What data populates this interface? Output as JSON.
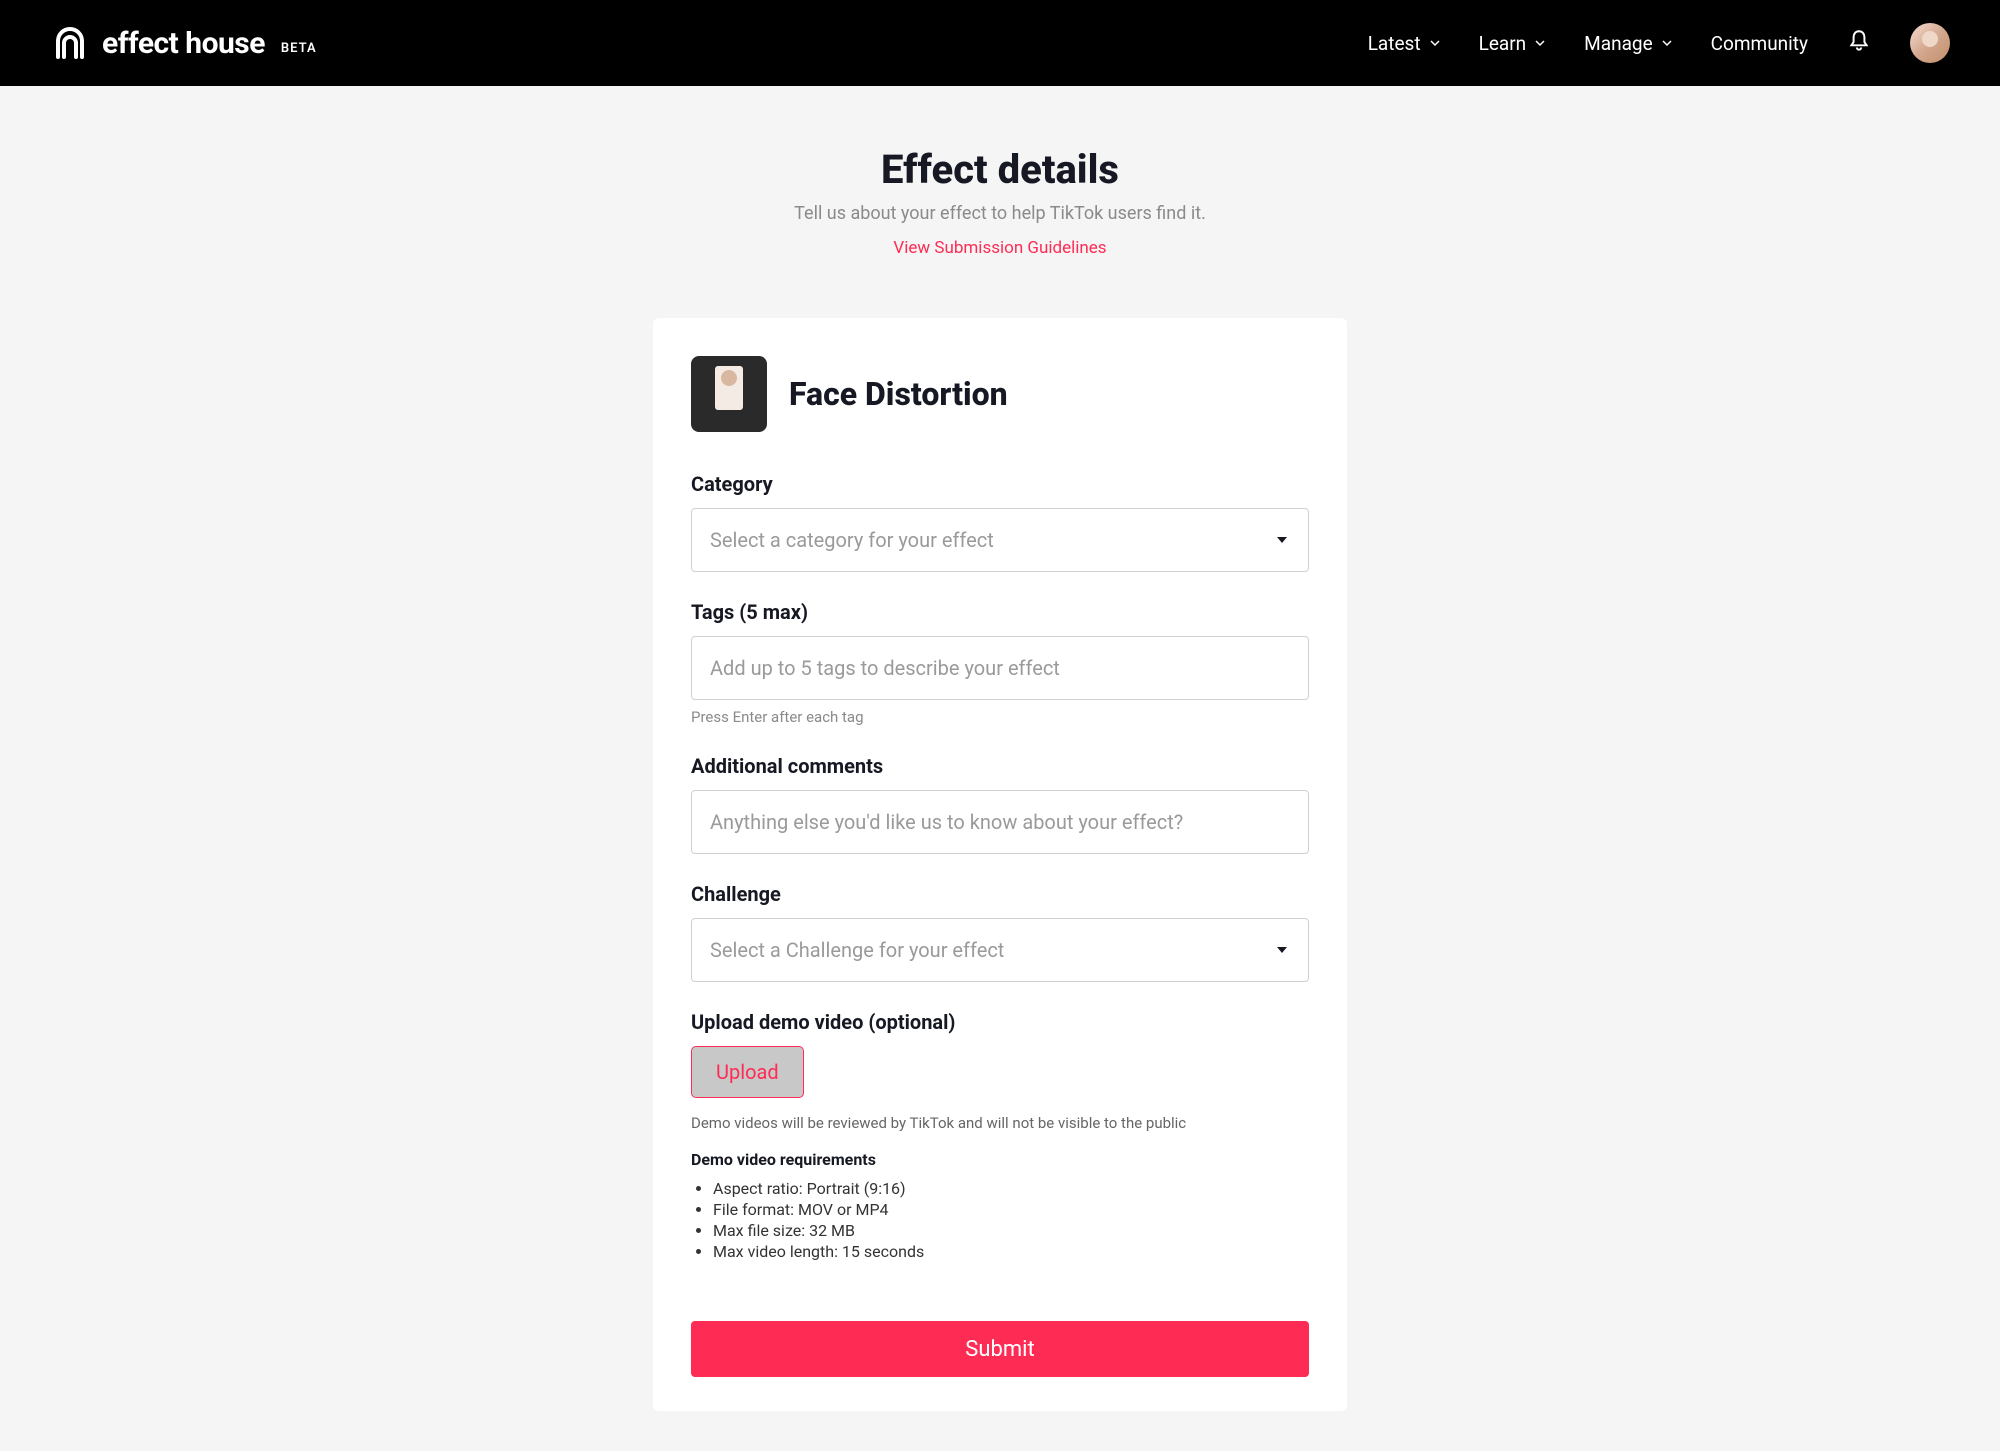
{
  "header": {
    "brand_name": "effect house",
    "brand_badge": "BETA",
    "nav": {
      "latest": "Latest",
      "learn": "Learn",
      "manage": "Manage",
      "community": "Community"
    }
  },
  "page": {
    "title": "Effect details",
    "subtitle": "Tell us about your effect to help TikTok users find it.",
    "guidelines_link": "View Submission Guidelines"
  },
  "effect": {
    "name": "Face Distortion"
  },
  "form": {
    "category": {
      "label": "Category",
      "placeholder": "Select a category for your effect"
    },
    "tags": {
      "label": "Tags (5 max)",
      "placeholder": "Add up to 5 tags to describe your effect",
      "hint": "Press Enter after each tag"
    },
    "comments": {
      "label": "Additional comments",
      "placeholder": "Anything else you'd like us to know about your effect?"
    },
    "challenge": {
      "label": "Challenge",
      "placeholder": "Select a Challenge for your effect"
    },
    "upload": {
      "label": "Upload demo video (optional)",
      "button": "Upload",
      "note": "Demo videos will be reviewed by TikTok and will not be visible to the public",
      "req_title": "Demo video requirements",
      "requirements": [
        "Aspect ratio: Portrait (9:16)",
        "File format: MOV or MP4",
        "Max file size: 32 MB",
        "Max video length: 15 seconds"
      ]
    },
    "submit": "Submit"
  },
  "colors": {
    "accent": "#fe2c55",
    "header_bg": "#000000",
    "page_bg": "#f5f5f5"
  }
}
